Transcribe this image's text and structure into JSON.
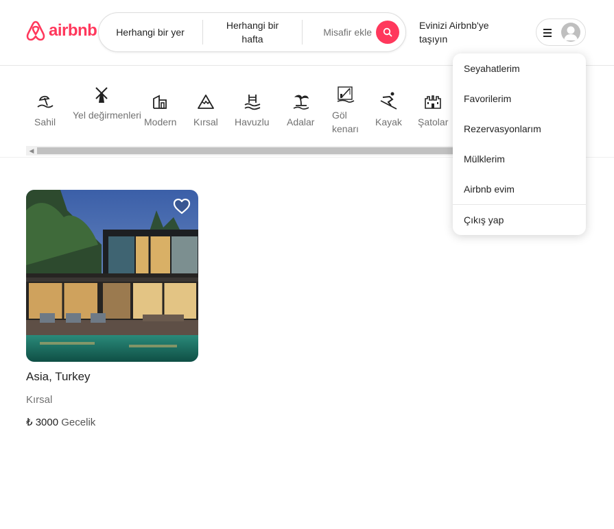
{
  "header": {
    "brand": "airbnb",
    "search": {
      "where": "Herhangi bir yer",
      "when": "Herhangi bir hafta",
      "guests": "Misafir ekle"
    },
    "host_link": "Evinizi Airbnb'ye taşıyın"
  },
  "categories": [
    {
      "label": "Sahil",
      "icon": "beach-icon"
    },
    {
      "label": "Yel değirmenleri",
      "icon": "windmill-icon"
    },
    {
      "label": "Modern",
      "icon": "modern-house-icon"
    },
    {
      "label": "Kırsal",
      "icon": "mountain-icon"
    },
    {
      "label": "Havuzlu",
      "icon": "pool-icon"
    },
    {
      "label": "Adalar",
      "icon": "island-icon"
    },
    {
      "label": "Göl kenarı",
      "icon": "lake-fishing-icon"
    },
    {
      "label": "Kayak",
      "icon": "ski-icon"
    },
    {
      "label": "Şatolar",
      "icon": "castle-icon"
    }
  ],
  "listings": [
    {
      "title": "Asia, Turkey",
      "type": "Kırsal",
      "currency": "₺",
      "price": "3000",
      "per": "Gecelik"
    }
  ],
  "user_menu": {
    "items": [
      "Seyahatlerim",
      "Favorilerim",
      "Rezervasyonlarım",
      "Mülklerim",
      "Airbnb evim"
    ],
    "logout": "Çıkış yap"
  },
  "colors": {
    "brand": "#ff385c",
    "text": "#222222",
    "muted": "#717171"
  }
}
